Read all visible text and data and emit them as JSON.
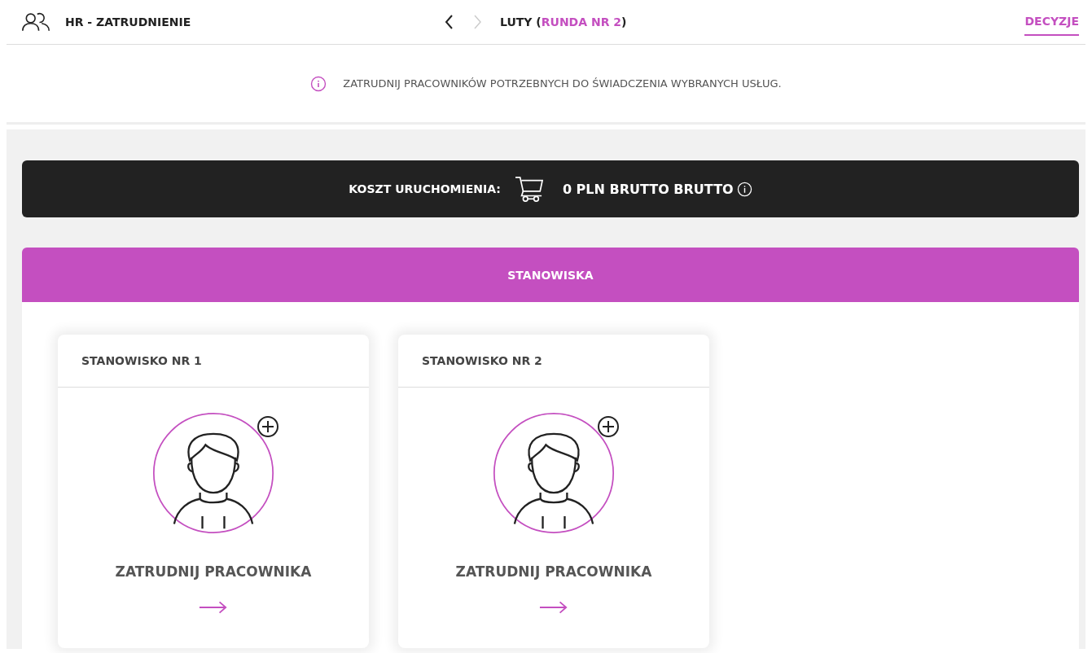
{
  "header": {
    "title": "HR - ZATRUDNIENIE",
    "period": {
      "prefix": "LUTY (",
      "highlight": "RUNDA NR 2",
      "suffix": ")"
    },
    "prev_disabled": false,
    "next_disabled": true,
    "tabs": [
      {
        "label": "DECYZJE",
        "selected": true
      }
    ]
  },
  "info": "ZATRUDNIJ PRACOWNIKÓW POTRZEBNYCH DO ŚWIADCZENIA WYBRANYCH USŁUG.",
  "cost_bar": {
    "label": "KOSZT URUCHOMIENIA:",
    "value": "0 PLN BRUTTO BRUTTO"
  },
  "positions": {
    "title": "STANOWISKA",
    "cards": [
      {
        "title": "STANOWISKO NR 1",
        "action": "ZATRUDNIJ PRACOWNIKA"
      },
      {
        "title": "STANOWISKO NR 2",
        "action": "ZATRUDNIJ PRACOWNIKA"
      }
    ]
  }
}
